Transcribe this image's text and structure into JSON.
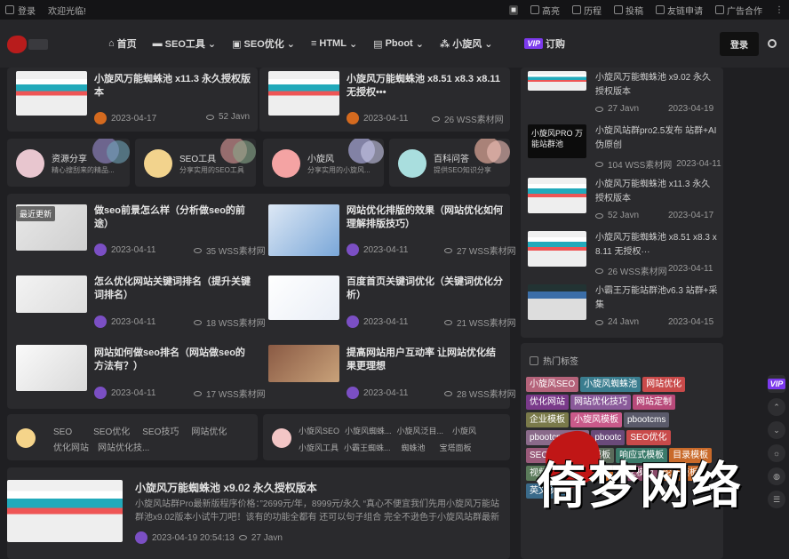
{
  "topbar": {
    "login": "登录",
    "welcome": "欢迎光临!",
    "right_items": [
      "高亮",
      "历程",
      "投稿",
      "友链申请",
      "广告合作"
    ]
  },
  "nav": {
    "items": [
      "首页",
      "SEO工具",
      "SEO优化",
      "HTML",
      "Pboot",
      "小旋风"
    ],
    "vip_badge": "VIP",
    "vip_label": "订购",
    "login_button": "登录"
  },
  "top_posts": [
    {
      "title": "小旋风万能蜘蛛池 x11.3 永久授权版本",
      "date": "2023-04-17",
      "views": "52 Javn"
    },
    {
      "title": "小旋风万能蜘蛛池 x8.51 x8.3 x8.11 无授权•••",
      "date": "2023-04-11",
      "views": "26 WSS素材网"
    }
  ],
  "categories": [
    {
      "name": "资源分享",
      "desc": "精心搜刮来的精品..."
    },
    {
      "name": "SEO工具",
      "desc": "分享实用的SEO工具"
    },
    {
      "name": "小旋风",
      "desc": "分享实用的小旋风..."
    },
    {
      "name": "百科问答",
      "desc": "提供SEO知识分享"
    }
  ],
  "recent_badge": "最近更新",
  "posts": [
    {
      "title": "做seo前景怎么样（分析做seo的前途）",
      "date": "2023-04-11",
      "views": "35 WSS素材网"
    },
    {
      "title": "网站优化排版的效果（网站优化如何理解排版技巧）",
      "date": "2023-04-11",
      "views": "27 WSS素材网"
    },
    {
      "title": "怎么优化网站关键词排名（提升关键词排名）",
      "date": "2023-04-11",
      "views": "18 WSS素材网"
    },
    {
      "title": "百度首页关键词优化（关键词优化分析）",
      "date": "2023-04-11",
      "views": "21 WSS素材网"
    },
    {
      "title": "网站如何做seo排名（网站做seo的方法有？）",
      "date": "2023-04-11",
      "views": "17 WSS素材网"
    },
    {
      "title": "提高网站用户互动率 让网站优化结果更理想",
      "date": "2023-04-11",
      "views": "28 WSS素材网"
    }
  ],
  "tag_group_left": [
    "SEO",
    "SEO优化",
    "SEO技巧",
    "网站优化",
    "优化网站",
    "网站优化技..."
  ],
  "tag_group_right": [
    "小旋风SEO",
    "小旋风蜘蛛...",
    "小旋风泛目...",
    "小旋风",
    "小旋风工具",
    "小霸王蜘蛛...",
    "蜘蛛池",
    "宝塔面板"
  ],
  "featured": {
    "title": "小旋风万能蜘蛛池 x9.02 永久授权版本",
    "excerpt": "小旋风站群Pro最新版程序价格：”2699元/年，8999元/永久 “真心不便宜我们先用小旋风万能站群池x9.02版本小试牛刀吧！该有的功能全都有 还可以句子组合 完全不逊色于小旋风站群最新版Pro...",
    "datetime": "2023-04-19 20:54:13",
    "views": "27 Javn"
  },
  "sidebar_posts": [
    {
      "title": "小旋风万能蜘蛛池 x9.02 永久授权版本",
      "views": "27 Javn",
      "date": "2023-04-19"
    },
    {
      "title": "小旋风站群pro2.5发布 站群+AI伪原创",
      "views": "104 WSS素材网",
      "date": "2023-04-11"
    },
    {
      "title": "小旋风万能蜘蛛池 x11.3 永久授权版本",
      "views": "52 Javn",
      "date": "2023-04-17"
    },
    {
      "title": "小旋风万能蜘蛛池 x8.51 x8.3 x 8.11 无授权···",
      "views": "26 WSS素材网",
      "date": "2023-04-11"
    },
    {
      "title": "小霸王万能站群池v6.3 站群+采集",
      "views": "24 Javn",
      "date": "2023-04-15"
    }
  ],
  "sidebar_thumb_text": "小旋风PRO 万能站群池",
  "hot_tags_title": "热门标签",
  "hot_tags": [
    {
      "label": "小旋风SEO",
      "color": "#b5637a"
    },
    {
      "label": "小旋风蜘蛛池",
      "color": "#3a7d8f"
    },
    {
      "label": "网站优化",
      "color": "#c94a4a"
    },
    {
      "label": "优化网站",
      "color": "#7a3a8a"
    },
    {
      "label": "网站优化技巧",
      "color": "#8a5a9a"
    },
    {
      "label": "网站定制",
      "color": "#b84a7a"
    },
    {
      "label": "企业模板",
      "color": "#7a7a4a"
    },
    {
      "label": "小旋风模板",
      "color": "#c95a8a"
    },
    {
      "label": "pbootcms",
      "color": "#5a5a6a"
    },
    {
      "label": "pbootcms教程",
      "color": "#8a6a8a"
    },
    {
      "label": "pbootc",
      "color": "#6a4a7a"
    },
    {
      "label": "SEO优化",
      "color": "#c94a4a"
    },
    {
      "label": "SEO技巧",
      "color": "#9a5a7a"
    },
    {
      "label": "小说模板",
      "color": "#5a6a5a"
    },
    {
      "label": "响应式模板",
      "color": "#3a7a6a"
    },
    {
      "label": "目录模板",
      "color": "#c96a2a"
    },
    {
      "label": "视频模板",
      "color": "#5a7a5a"
    },
    {
      "label": "网站模板",
      "color": "#c96a2a"
    },
    {
      "label": "作文模板",
      "color": "#8a4a6a"
    },
    {
      "label": "论坛模板",
      "color": "#c96a2a"
    },
    {
      "label": "英文模板",
      "color": "#3a6a8a"
    }
  ],
  "watermark": "倚梦网络"
}
